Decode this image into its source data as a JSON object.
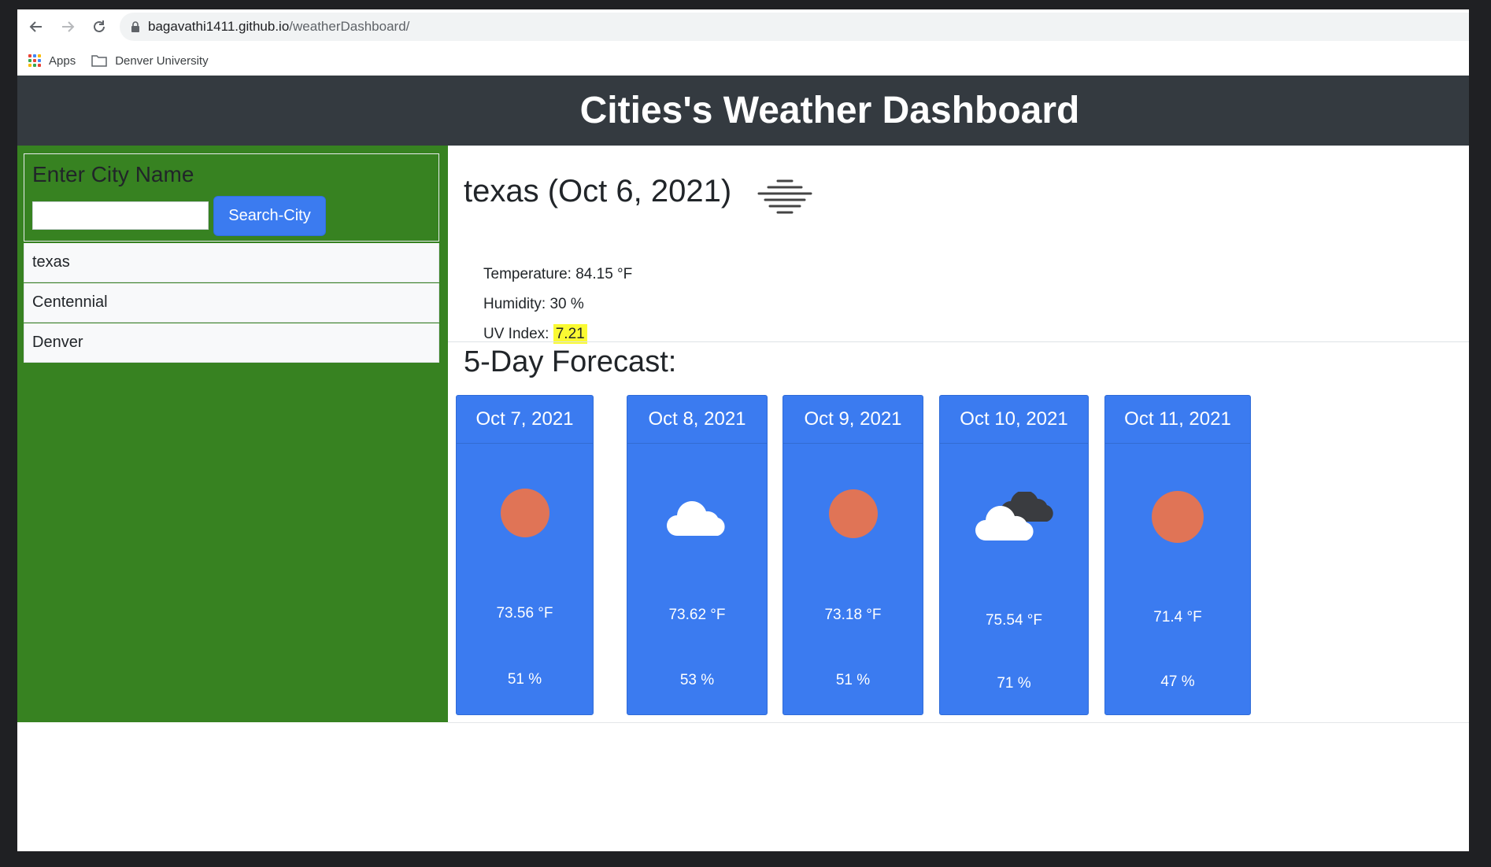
{
  "browser": {
    "url_host": "bagavathi1411.github.io",
    "url_path": "/weatherDashboard/",
    "bookmarks": [
      {
        "label": "Apps",
        "icon": "apps-grid-icon"
      },
      {
        "label": "Denver University",
        "icon": "folder-icon"
      }
    ]
  },
  "header": {
    "title": "Cities's Weather Dashboard",
    "background": "#343a40"
  },
  "sidebar": {
    "background": "#378221",
    "heading": "Enter City Name",
    "search_value": "",
    "search_button": "Search-City",
    "history": [
      "texas",
      "Centennial",
      "Denver"
    ]
  },
  "current": {
    "title": "texas (Oct 6, 2021)",
    "icon": "mist-icon",
    "temperature": "Temperature: 84.15 °F",
    "humidity": "Humidity: 30 %",
    "uv_label": "UV Index: ",
    "uv_value": "7.21",
    "uv_color": "#fafa32"
  },
  "forecast": {
    "heading": "5-Day Forecast:",
    "card_color": "#3b7bf0",
    "days": [
      {
        "date": "Oct 7, 2021",
        "icon": "sun-icon",
        "temp": "73.56 °F",
        "humidity": "51 %"
      },
      {
        "date": "Oct 8, 2021",
        "icon": "cloud-icon",
        "temp": "73.62 °F",
        "humidity": "53 %"
      },
      {
        "date": "Oct 9, 2021",
        "icon": "sun-icon",
        "temp": "73.18 °F",
        "humidity": "51 %"
      },
      {
        "date": "Oct 10, 2021",
        "icon": "broken-clouds-icon",
        "temp": "75.54 °F",
        "humidity": "71 %"
      },
      {
        "date": "Oct 11, 2021",
        "icon": "sun-icon",
        "temp": "71.4 °F",
        "humidity": "47 %"
      }
    ]
  }
}
